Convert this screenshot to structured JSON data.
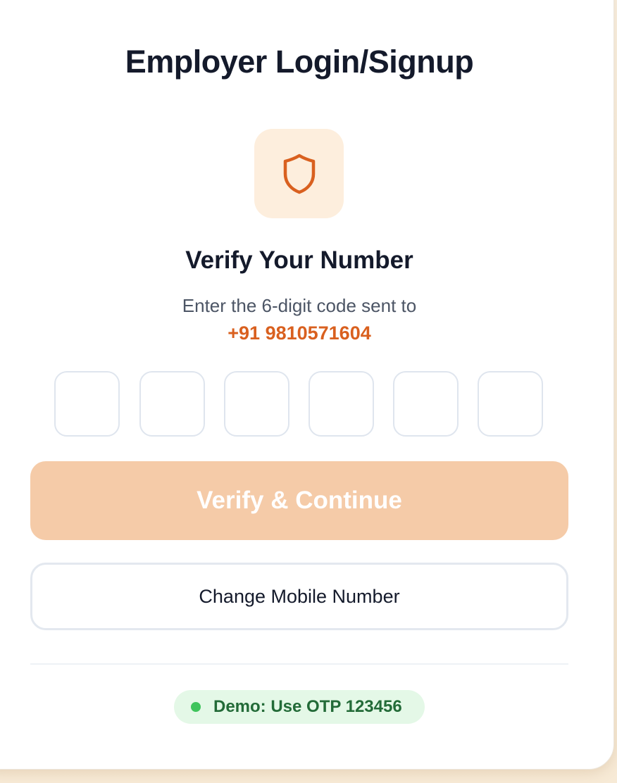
{
  "header": {
    "title": "Employer Login/Signup"
  },
  "verify": {
    "icon": "shield-icon",
    "heading": "Verify Your Number",
    "instruction": "Enter the 6-digit code sent to",
    "phone_number": "+91 9810571604"
  },
  "otp": {
    "digits": [
      "",
      "",
      "",
      "",
      "",
      ""
    ]
  },
  "actions": {
    "verify_label": "Verify & Continue",
    "change_number_label": "Change Mobile Number"
  },
  "demo": {
    "note": "Demo: Use OTP 123456"
  },
  "colors": {
    "accent": "#d9601f",
    "accent_soft": "#fdeedd",
    "button_disabled": "#f5cba8",
    "success": "#3fc45c"
  }
}
